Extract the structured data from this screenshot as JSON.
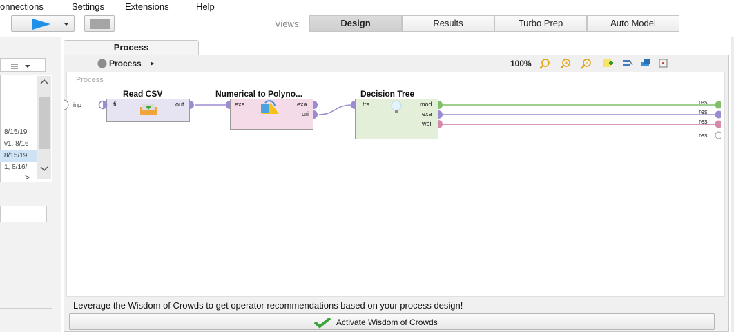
{
  "menubar": {
    "items": [
      "onnections",
      "Settings",
      "Extensions",
      "Help"
    ]
  },
  "toolbar": {
    "views_label": "Views:",
    "view_tabs": [
      "Design",
      "Results",
      "Turbo Prep",
      "Auto Model"
    ],
    "active_view": "Design"
  },
  "left_panel": {
    "rows": [
      "8/15/19",
      "v1, 8/16",
      "8/15/19",
      "1, 8/16/"
    ],
    "selected_row": 2,
    "scroll_right_glyph": ">"
  },
  "process": {
    "tab_label": "Process",
    "breadcrumb": "Process",
    "breadcrumb_arrow": "▸",
    "zoom": "100%",
    "canvas_label": "Process",
    "input_port": "inp",
    "output_ports": [
      "res",
      "res",
      "res",
      "res"
    ],
    "operators": [
      {
        "title": "Read CSV",
        "in_ports": [
          "fil"
        ],
        "out_ports": [
          "out"
        ]
      },
      {
        "title": "Numerical to Polyno...",
        "in_ports": [
          "exa"
        ],
        "out_ports": [
          "exa",
          "ori"
        ]
      },
      {
        "title": "Decision Tree",
        "in_ports": [
          "tra"
        ],
        "out_ports": [
          "mod",
          "exa",
          "wei"
        ]
      }
    ]
  },
  "wisdom": {
    "message": "Leverage the Wisdom of Crowds to get operator recommendations based on your process design!",
    "button_label": "Activate Wisdom of Crowds"
  },
  "colors": {
    "read_csv_fill": "#e6e4f3",
    "numerical_fill": "#f5dbe8",
    "decision_fill": "#e3efd8",
    "port_purple": "#9b8bd0",
    "port_green": "#7fbf6a",
    "port_pink": "#d48aa8",
    "wire_green": "#7fbf6a",
    "wire_purple": "#9b8bd0",
    "wire_pink": "#c87aa0"
  }
}
